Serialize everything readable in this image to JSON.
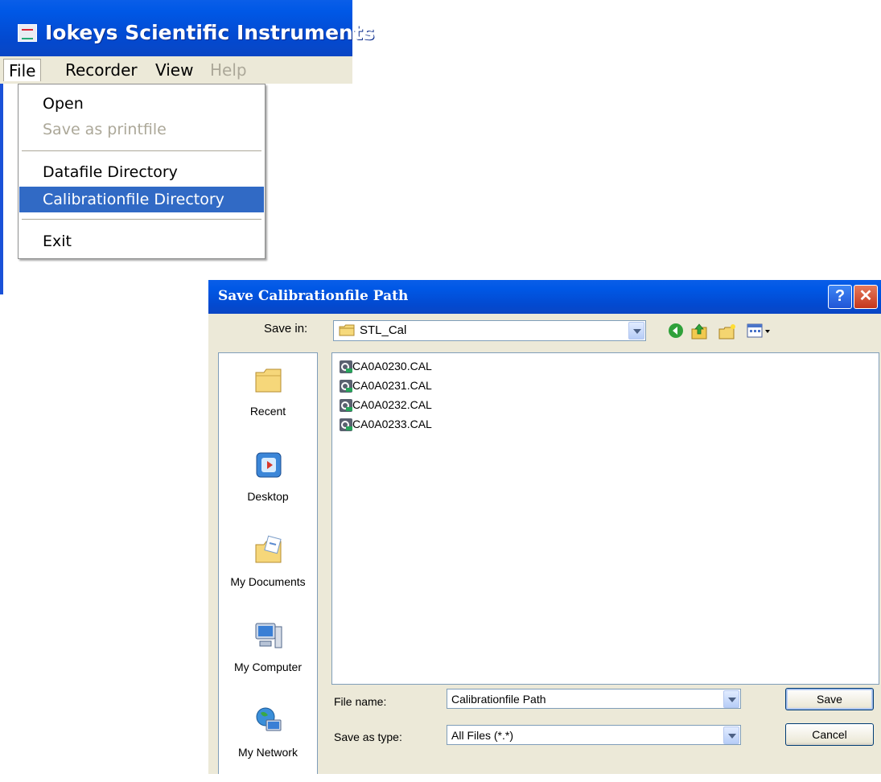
{
  "app": {
    "title": "Iokeys Scientific Instruments",
    "menubar": [
      "File",
      "Recorder",
      "View",
      "Help"
    ],
    "file_menu": {
      "items": [
        "Open",
        "Save as printfile",
        "Datafile Directory",
        "Calibrationfile Directory",
        "Exit"
      ],
      "highlighted": "Calibrationfile Directory",
      "disabled": [
        "Save as printfile"
      ]
    }
  },
  "dialog": {
    "title": "Save Calibrationfile Path",
    "help_symbol": "?",
    "close_symbol": "✕",
    "save_in": {
      "label": "Save in:",
      "value": "STL_Cal"
    },
    "places": [
      "Recent",
      "Desktop",
      "My Documents",
      "My Computer",
      "My Network"
    ],
    "files": [
      "CA0A0230.CAL",
      "CA0A0231.CAL",
      "CA0A0232.CAL",
      "CA0A0233.CAL"
    ],
    "file_name": {
      "label": "File name:",
      "value": "Calibrationfile Path"
    },
    "save_as_type": {
      "label": "Save as type:",
      "value": "All Files (*.*)"
    },
    "buttons": {
      "save": "Save",
      "cancel": "Cancel"
    }
  }
}
